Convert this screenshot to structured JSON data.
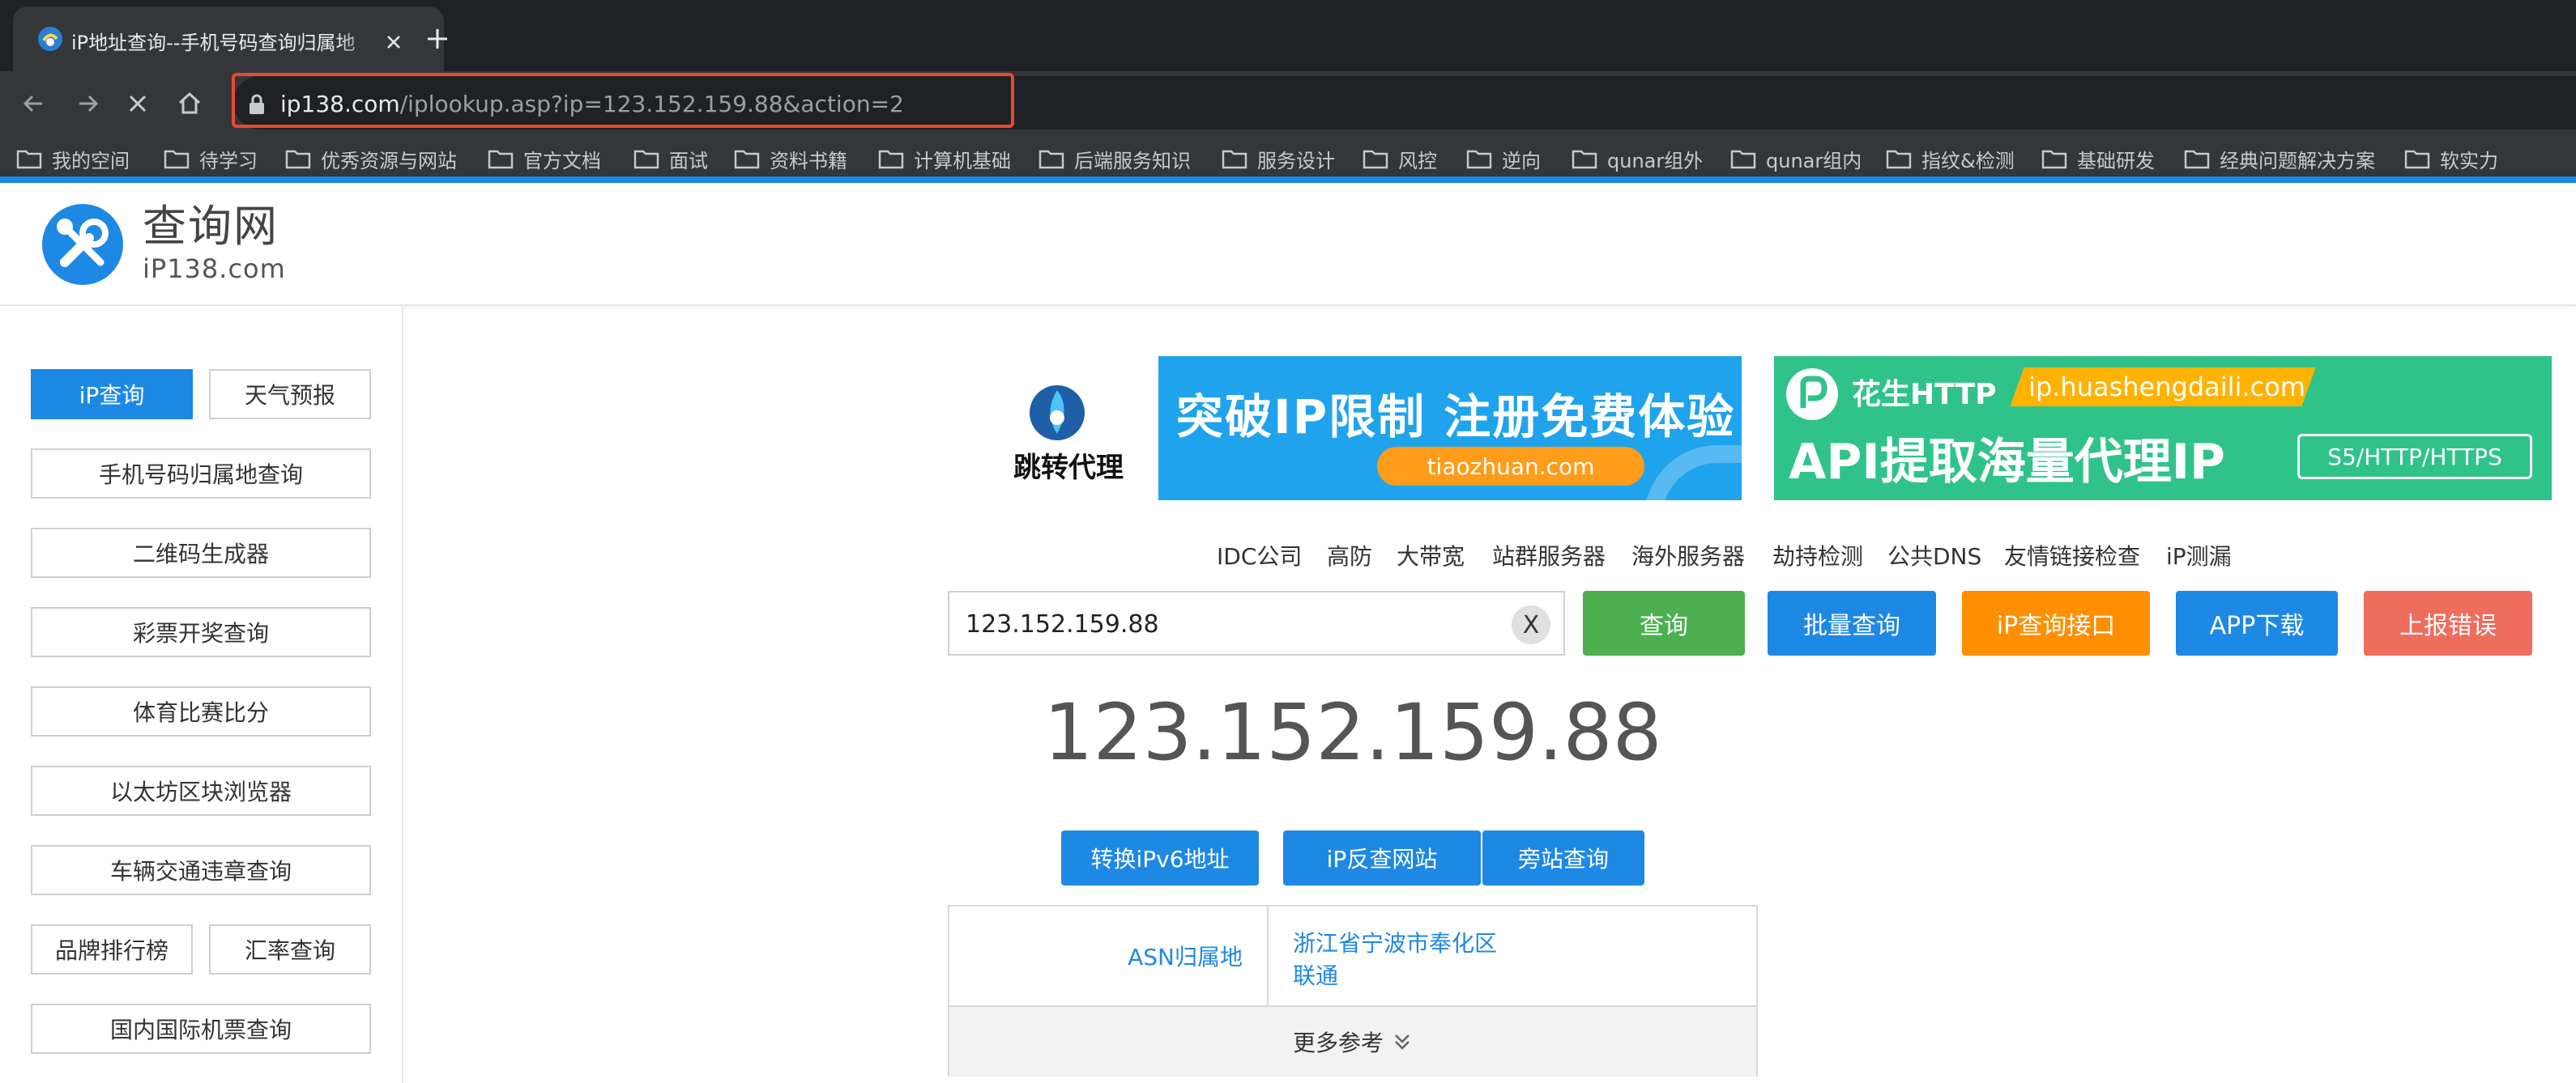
{
  "browser": {
    "tab_title": "iP地址查询--手机号码查询归属地",
    "url_host": "ip138.com",
    "url_path": "/iplookup.asp?ip=123.152.159.88&action=2"
  },
  "bookmarks": [
    {
      "label": "我的空间"
    },
    {
      "label": "待学习"
    },
    {
      "label": "优秀资源与网站"
    },
    {
      "label": "官方文档"
    },
    {
      "label": "面试"
    },
    {
      "label": "资料书籍"
    },
    {
      "label": "计算机基础"
    },
    {
      "label": "后端服务知识"
    },
    {
      "label": "服务设计"
    },
    {
      "label": "风控"
    },
    {
      "label": "逆向"
    },
    {
      "label": "qunar组外"
    },
    {
      "label": "qunar组内"
    },
    {
      "label": "指纹&检测"
    },
    {
      "label": "基础研发"
    },
    {
      "label": "经典问题解决方案"
    },
    {
      "label": "软实力"
    }
  ],
  "site": {
    "logo_cn": "查询网",
    "logo_en": "iP138.com"
  },
  "sidebar": {
    "items": [
      {
        "label": "iP查询"
      },
      {
        "label": "天气预报"
      },
      {
        "label": "手机号码归属地查询"
      },
      {
        "label": "二维码生成器"
      },
      {
        "label": "彩票开奖查询"
      },
      {
        "label": "体育比赛比分"
      },
      {
        "label": "以太坊区块浏览器"
      },
      {
        "label": "车辆交通违章查询"
      },
      {
        "label": "品牌排行榜"
      },
      {
        "label": "汇率查询"
      },
      {
        "label": "国内国际机票查询"
      }
    ]
  },
  "ads": {
    "ad1": {
      "brand": "跳转代理",
      "slogan": "突破IP限制 注册免费体验",
      "domain": "tiaozhuan.com"
    },
    "ad2": {
      "brand": "花生HTTP",
      "domain": "ip.huashengdaili.com",
      "slogan": "API提取海量代理IP",
      "badge": "S5/HTTP/HTTPS"
    }
  },
  "quicklinks": [
    "IDC公司",
    "高防",
    "大带宽",
    "站群服务器",
    "海外服务器",
    "劫持检测",
    "公共DNS",
    "友情链接检查",
    "iP测漏"
  ],
  "search": {
    "value": "123.152.159.88",
    "clear_label": "X",
    "buttons": {
      "query": "查询",
      "batch": "批量查询",
      "api": "iP查询接口",
      "app": "APP下载",
      "report": "上报错误"
    }
  },
  "result": {
    "ip": "123.152.159.88",
    "actions": [
      "转换iPv6地址",
      "iP反查网站",
      "旁站查询"
    ],
    "asn_label": "ASN归属地",
    "location": "浙江省宁波市奉化区",
    "isp": "联通",
    "more_label": "更多参考"
  },
  "colors": {
    "blue": "#1e88e5",
    "green": "#4caf50",
    "orange": "#ff8f00",
    "red": "#ef6d5d",
    "highlight": "#e8492e"
  }
}
